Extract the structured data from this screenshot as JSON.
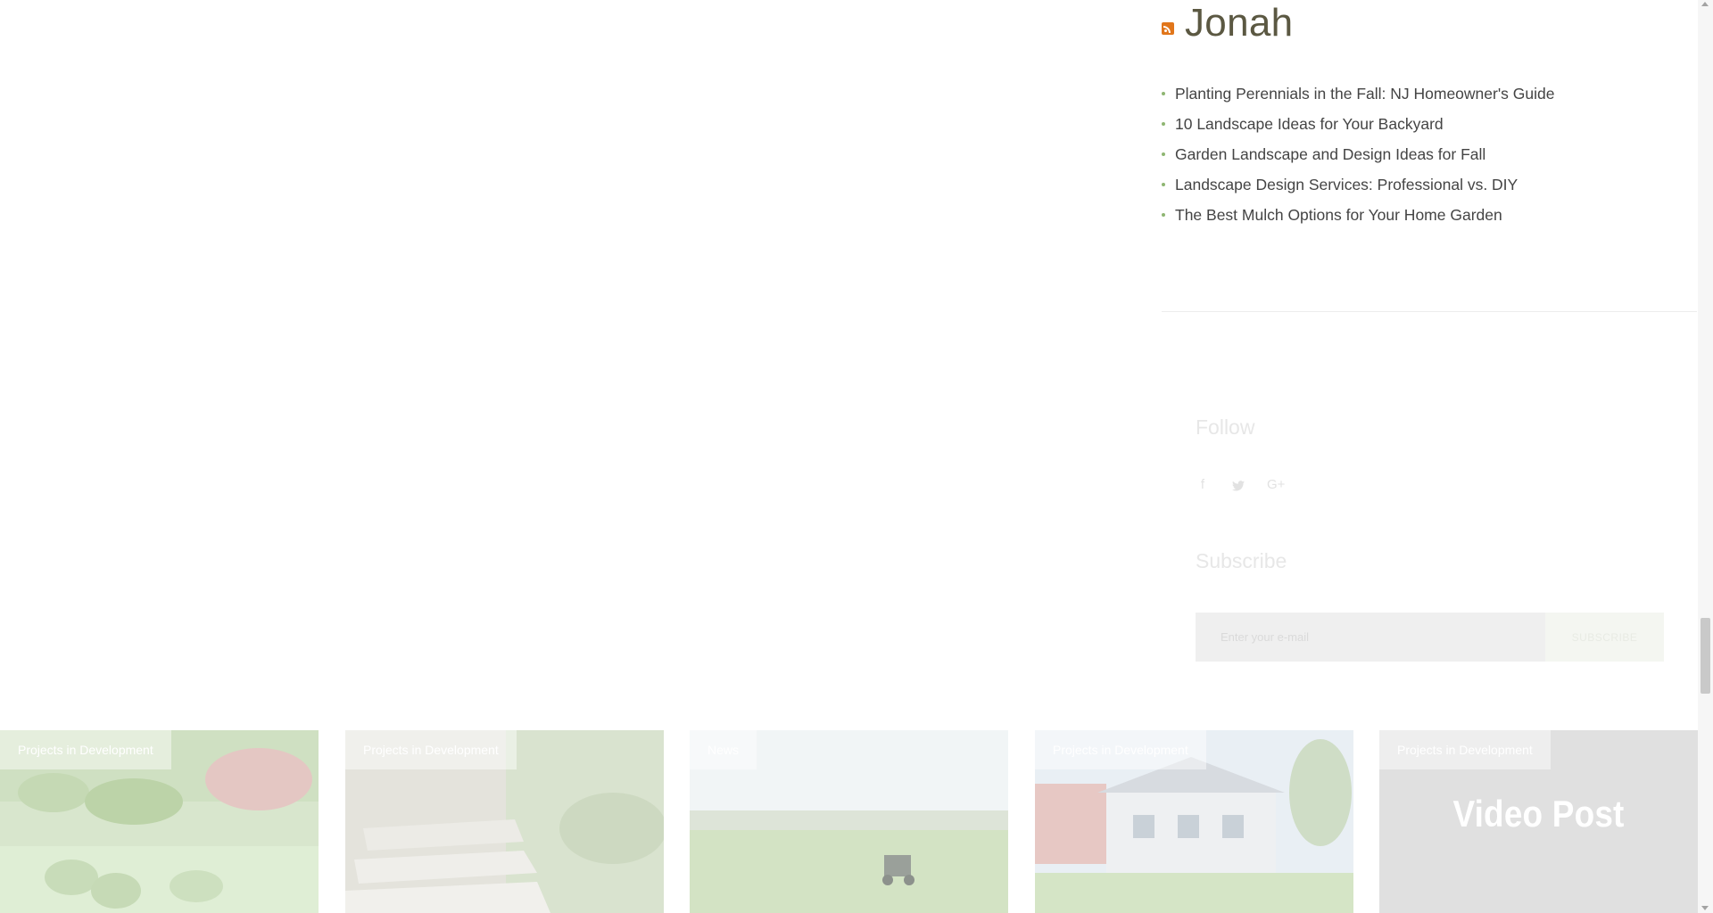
{
  "sidebar": {
    "feed_title": "Jonah",
    "posts": [
      "Planting Perennials in the Fall: NJ Homeowner's Guide",
      "10 Landscape Ideas for Your Backyard",
      "Garden Landscape and Design Ideas for Fall",
      "Landscape Design Services: Professional vs. DIY",
      "The Best Mulch Options for Your Home Garden"
    ],
    "follow": {
      "title": "Follow",
      "icons": [
        "facebook-icon",
        "twitter-icon",
        "google-plus-icon"
      ],
      "glyphs": [
        "f",
        "𝕥",
        "G+"
      ]
    },
    "subscribe": {
      "title": "Subscribe",
      "placeholder": "Enter your e-mail",
      "button": "SUBSCRIBE"
    }
  },
  "cards": [
    {
      "tag": "Projects in Development"
    },
    {
      "tag": "Projects in Development"
    },
    {
      "tag": "News"
    },
    {
      "tag": "Projects in Development"
    },
    {
      "tag": "Projects in Development",
      "title": "Video Post"
    }
  ],
  "colors": {
    "accent_bullet": "#8fb673",
    "rss": "#e1761b",
    "feed_title": "#5b5842"
  }
}
